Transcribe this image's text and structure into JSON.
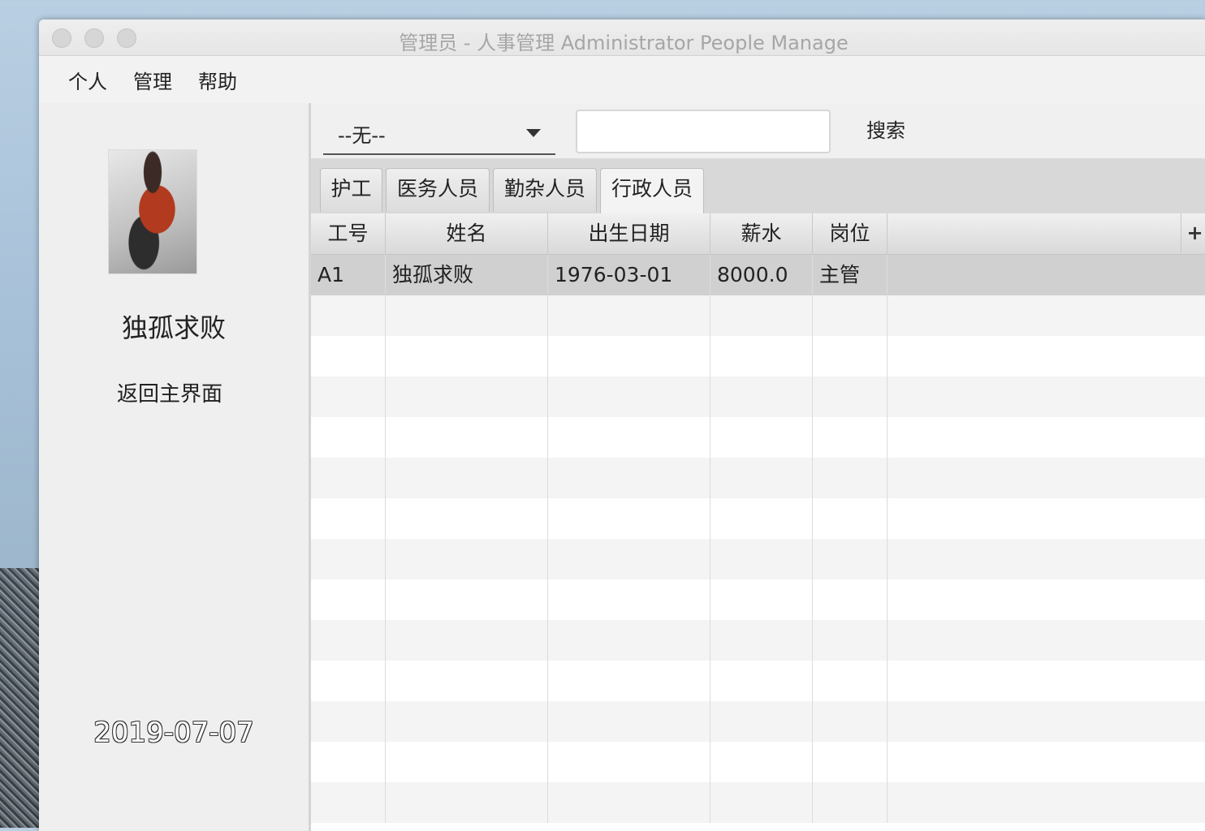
{
  "window": {
    "title": "管理员 - 人事管理 Administrator People Manage"
  },
  "menu": {
    "items": [
      "个人",
      "管理",
      "帮助"
    ]
  },
  "sidebar": {
    "avatar_icon": "user-avatar-image",
    "username": "独孤求败",
    "back_label": "返回主界面",
    "date": "2019-07-07"
  },
  "search": {
    "filter_value": "--无--",
    "input_value": "",
    "button_label": "搜索"
  },
  "tabs": [
    {
      "label": "护工",
      "active": false
    },
    {
      "label": "医务人员",
      "active": false
    },
    {
      "label": "勤杂人员",
      "active": false
    },
    {
      "label": "行政人员",
      "active": true
    }
  ],
  "table": {
    "columns": [
      "工号",
      "姓名",
      "出生日期",
      "薪水",
      "岗位"
    ],
    "add_column_icon": "plus-icon",
    "rows": [
      {
        "id": "A1",
        "name": "独孤求败",
        "birthdate": "1976-03-01",
        "salary": "8000.0",
        "position": "主管",
        "selected": true
      }
    ]
  }
}
